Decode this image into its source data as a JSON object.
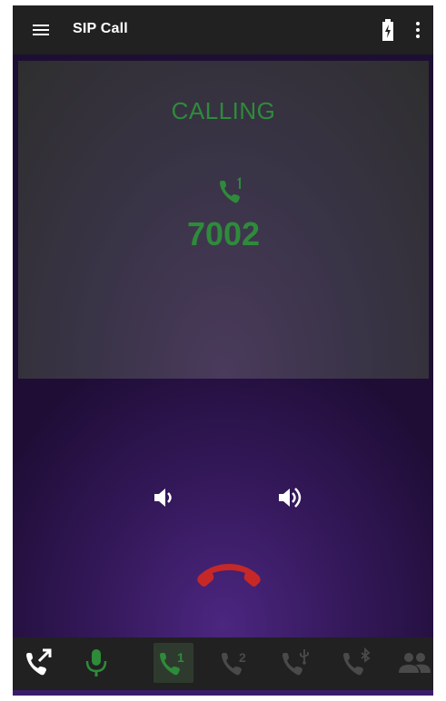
{
  "app_bar": {
    "title": "SIP Call"
  },
  "call": {
    "state": "CALLING",
    "number": "7002",
    "active_line": 1
  },
  "bottom_bar": {
    "buttons": [
      {
        "name": "transfer",
        "icon": "call-transfer-icon",
        "state": "enabled"
      },
      {
        "name": "mute",
        "icon": "microphone-icon",
        "state": "active"
      },
      {
        "name": "line-1",
        "icon": "phone-line-1-icon",
        "state": "selected",
        "label": "1"
      },
      {
        "name": "line-2",
        "icon": "phone-line-2-icon",
        "state": "disabled",
        "label": "2"
      },
      {
        "name": "usb-line",
        "icon": "phone-usb-icon",
        "state": "disabled"
      },
      {
        "name": "bluetooth-line",
        "icon": "phone-bluetooth-icon",
        "state": "disabled"
      },
      {
        "name": "conference",
        "icon": "group-icon",
        "state": "disabled"
      }
    ]
  },
  "colors": {
    "app_bar": "#212121",
    "calling_green": "#2e8b3a",
    "hangup_red": "#c62828",
    "disabled_icon": "#4a4a4a"
  }
}
